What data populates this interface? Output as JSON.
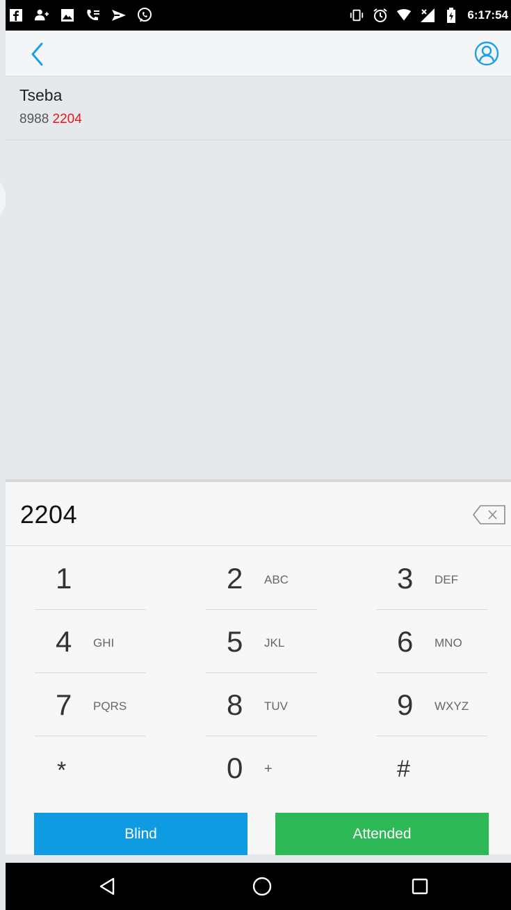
{
  "status_bar": {
    "time": "6:17:54",
    "left_icons": [
      "facebook-icon",
      "add-contact-icon",
      "gallery-icon",
      "phone-voicemail-icon",
      "send-icon",
      "viber-icon"
    ],
    "right_icons": [
      "vibrate-icon",
      "alarm-icon",
      "wifi-icon",
      "no-signal-icon",
      "battery-icon"
    ]
  },
  "header": {
    "back_icon": "chevron-left-icon",
    "contacts_icon": "contact-icon",
    "accent_color": "#1aa0e6"
  },
  "results": [
    {
      "name": "Tseba",
      "number_prefix": "8988 ",
      "number_match": "2204"
    }
  ],
  "dialpad": {
    "entry_value": "2204",
    "backspace_icon": "backspace-icon",
    "keys": [
      [
        {
          "digit": "1",
          "letters": ""
        },
        {
          "digit": "2",
          "letters": "ABC"
        },
        {
          "digit": "3",
          "letters": "DEF"
        }
      ],
      [
        {
          "digit": "4",
          "letters": "GHI"
        },
        {
          "digit": "5",
          "letters": "JKL"
        },
        {
          "digit": "6",
          "letters": "MNO"
        }
      ],
      [
        {
          "digit": "7",
          "letters": "PQRS"
        },
        {
          "digit": "8",
          "letters": "TUV"
        },
        {
          "digit": "9",
          "letters": "WXYZ"
        }
      ],
      [
        {
          "digit": "*",
          "letters": ""
        },
        {
          "digit": "0",
          "letters": "+"
        },
        {
          "digit": "#",
          "letters": ""
        }
      ]
    ],
    "blind_label": "Blind",
    "attended_label": "Attended",
    "blind_color": "#0f9be1",
    "attended_color": "#2dba56"
  },
  "nav_bar": {
    "back_icon": "triangle-back-icon",
    "home_icon": "circle-home-icon",
    "recents_icon": "square-recents-icon"
  }
}
